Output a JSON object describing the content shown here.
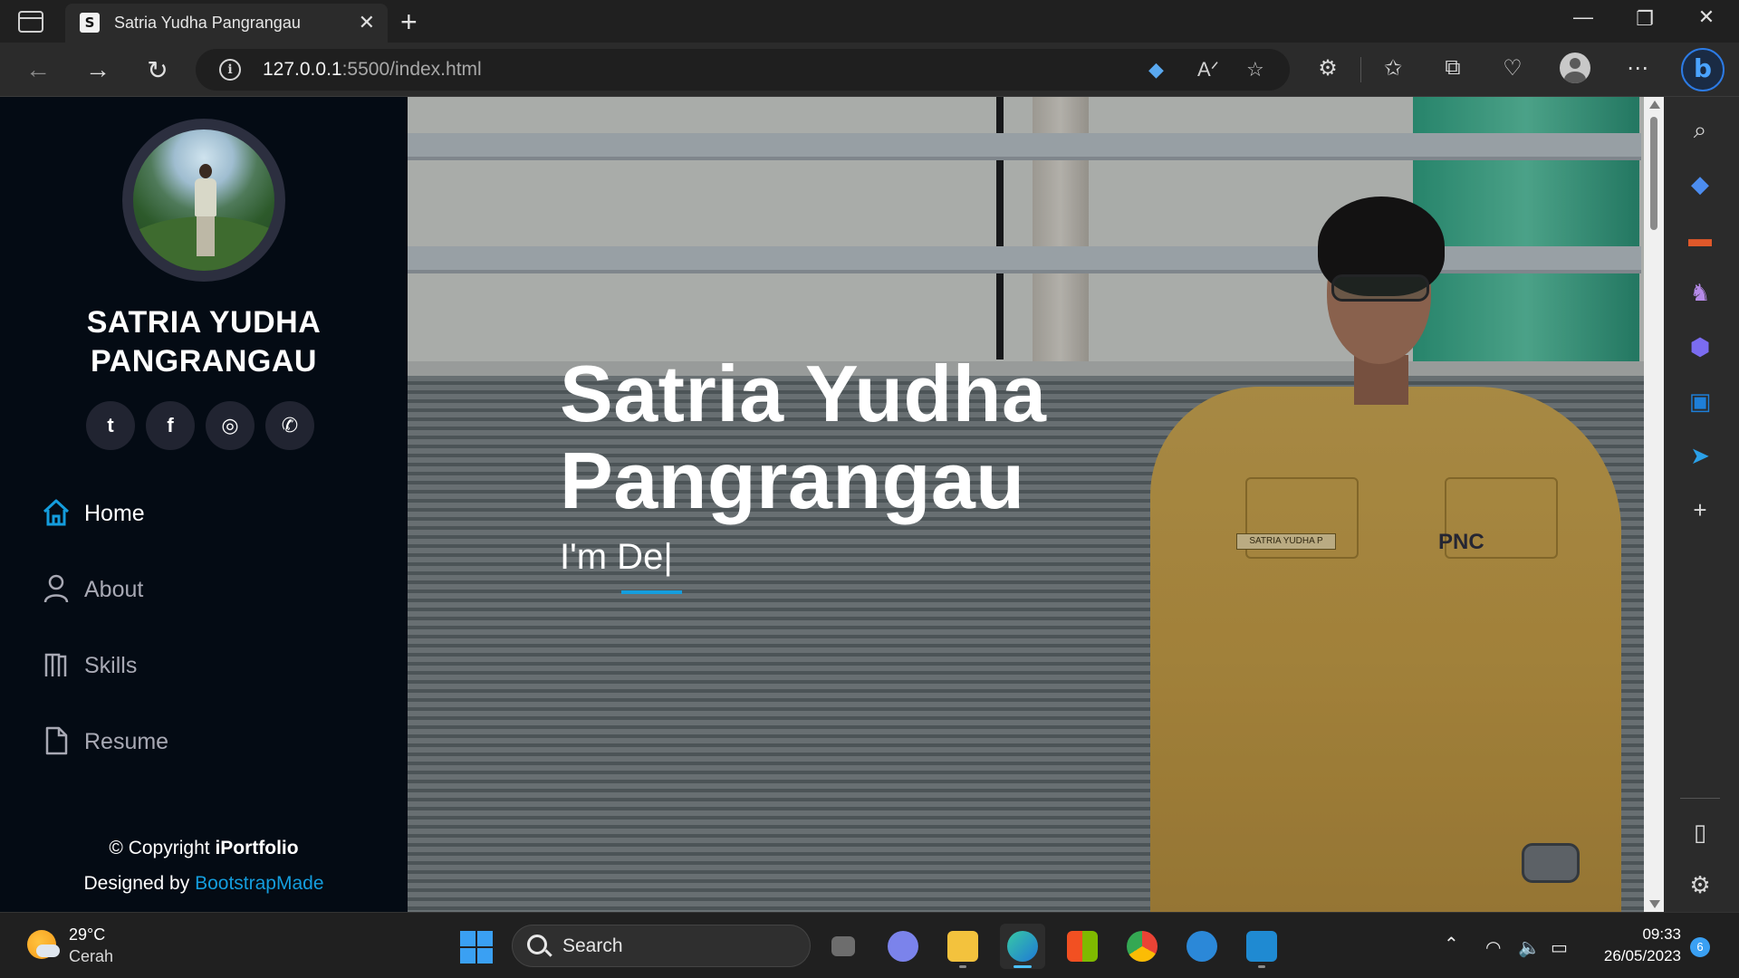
{
  "browser": {
    "tab_title": "Satria Yudha Pangrangau",
    "tab_favicon": "S",
    "url_host": "127.0.0.1",
    "url_rest": ":5500/index.html"
  },
  "profile": {
    "name_line1": "SATRIA YUDHA",
    "name_line2": "PANGRANGAU",
    "socials": [
      {
        "icon": "twitter-icon",
        "glyph": "t"
      },
      {
        "icon": "facebook-icon",
        "glyph": "f"
      },
      {
        "icon": "instagram-icon",
        "glyph": "◎"
      },
      {
        "icon": "whatsapp-icon",
        "glyph": "✆"
      }
    ]
  },
  "nav": {
    "items": [
      {
        "label": "Home",
        "icon": "home-icon",
        "active": true
      },
      {
        "label": "About",
        "icon": "person-icon",
        "active": false
      },
      {
        "label": "Skills",
        "icon": "skills-icon",
        "active": false
      },
      {
        "label": "Resume",
        "icon": "file-icon",
        "active": false
      }
    ]
  },
  "footer": {
    "copyright_prefix": "© Copyright ",
    "brand": "iPortfolio",
    "designed_by": "Designed by ",
    "designer": "BootstrapMade"
  },
  "hero": {
    "title_line1": "Satria Yudha",
    "title_line2": "Pangrangau",
    "subtitle": "I'm De|",
    "name_tag": "SATRIA YUDHA P",
    "shirt_logo": "PNC"
  },
  "taskbar": {
    "weather_temp": "29°C",
    "weather_desc": "Cerah",
    "search_placeholder": "Search",
    "time": "09:33",
    "date": "26/05/2023",
    "notifications": "6"
  },
  "colors": {
    "accent": "#149ddd",
    "sidebar_bg": "#040b14",
    "social_bg": "#212431"
  }
}
